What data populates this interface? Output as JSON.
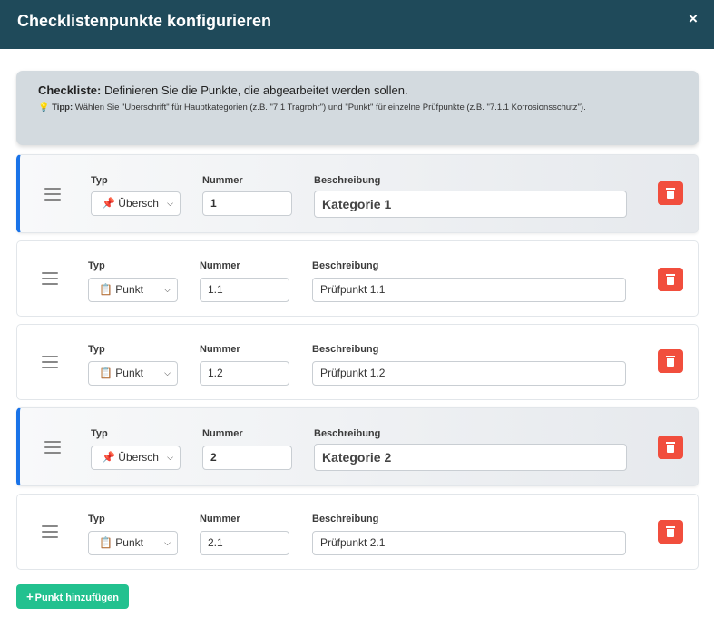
{
  "modal": {
    "title": "Checklistenpunkte konfigurieren",
    "close_glyph": "×",
    "close_icon": "close-icon"
  },
  "info": {
    "prefix": "Checkliste:",
    "text": " Definieren Sie die Punkte, die abgearbeitet werden sollen.",
    "tip_icon": "lightbulb-icon",
    "tip_glyph": "💡",
    "tip_label": "Tipp:",
    "tip_text": " Wählen Sie \"Überschrift\" für Hauptkategorien (z.B. \"7.1 Tragrohr\") und \"Punkt\" für einzelne Prüfpunkte (z.B. \"7.1.1 Korrosionsschutz\")."
  },
  "labels": {
    "type": "Typ",
    "number": "Nummer",
    "description": "Beschreibung"
  },
  "items": [
    {
      "kind": "heading",
      "type_icon": "📌",
      "type_label": "Übersch",
      "number": "1",
      "description": "Kategorie 1"
    },
    {
      "kind": "point",
      "type_icon": "📋",
      "type_label": "Punkt",
      "number": "1.1",
      "description": "Prüfpunkt 1.1"
    },
    {
      "kind": "point",
      "type_icon": "📋",
      "type_label": "Punkt",
      "number": "1.2",
      "description": "Prüfpunkt 1.2"
    },
    {
      "kind": "heading",
      "type_icon": "📌",
      "type_label": "Übersch",
      "number": "2",
      "description": "Kategorie 2"
    },
    {
      "kind": "point",
      "type_icon": "📋",
      "type_label": "Punkt",
      "number": "2.1",
      "description": "Prüfpunkt 2.1"
    }
  ],
  "add_button": {
    "plus_glyph": "+",
    "label": "Punkt hinzufügen"
  },
  "colors": {
    "header_bg": "#1f4a5a",
    "heading_accent": "#1a73e8",
    "delete_bg": "#f14e3d",
    "add_bg": "#22c18f"
  }
}
